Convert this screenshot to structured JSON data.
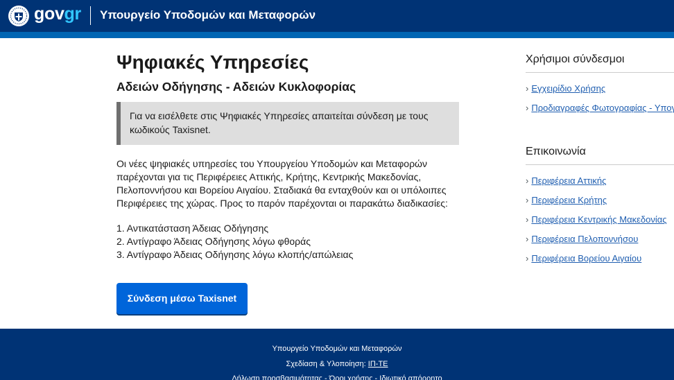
{
  "header": {
    "logo_gov": "gov",
    "logo_gr": "gr",
    "ministry_title": "Υπουργείο Υποδομών και Μεταφορών"
  },
  "main": {
    "title": "Ψηφιακές Υπηρεσίες",
    "subtitle": "Αδειών Οδήγησης - Αδειών Κυκλοφορίας",
    "notice_line1": "Για να εισέλθετε στις Ψηφιακές Υπηρεσίες απαιτείται σύνδεση με τους",
    "notice_line2": "κωδικούς Taxisnet.",
    "intro_lines": [
      "Οι νέες ψηφιακές υπηρεσίες του Υπουργείου Υποδομών και Μεταφορών",
      "παρέχονται για τις Περιφέρειες Αττικής, Κρήτης, Κεντρικής Μακεδονίας,",
      "Πελοποννήσου και Βορείου Αιγαίου. Σταδιακά θα ενταχθούν και οι υπόλοιπες",
      "Περιφέρειες της χώρας. Προς το παρόν παρέχονται οι παρακάτω διαδικασίες:"
    ],
    "procedures": [
      "1. Αντικατάσταση Άδειας Οδήγησης",
      "2. Αντίγραφο Άδειας Οδήγησης λόγω φθοράς",
      "3. Αντίγραφο Άδειας Οδήγησης λόγω κλοπής/απώλειας"
    ],
    "login_button": "Σύνδεση μέσω Taxisnet"
  },
  "sidebar": {
    "useful_heading": "Χρήσιμοι σύνδεσμοι",
    "useful_links": [
      "Εγχειρίδιο Χρήσης",
      "Προδιαγραφές Φωτογραφίας - Υπογρ"
    ],
    "contact_heading": "Επικοινωνία",
    "contact_links": [
      "Περιφέρεια Αττικής",
      "Περιφέρεια Κρήτης",
      "Περιφέρεια Κεντρικής Μακεδονίας",
      "Περιφέρεια Πελοποννήσου",
      "Περιφέρεια Βορείου Αιγαίου"
    ],
    "chevron": "›"
  },
  "footer": {
    "line1": "Υπουργείο Υποδομών και Μεταφορών",
    "design_label": "Σχεδίαση & Υλοποίηση:",
    "design_link": "ΙΠ-ΤΕ",
    "line3": "Δήλωση προσβασιμότητας - Όροι χρήσης - Ιδιωτικό απόρρητο"
  },
  "colors": {
    "header_bg": "#003375",
    "header_stripe": "#0065b3",
    "logo_gr": "#32c6ff",
    "button_bg": "#0065da",
    "link": "#1f5eb0",
    "notice_bg": "#dedede",
    "notice_border": "#6f6f6f"
  },
  "icons": {
    "emblem": "greek-coat-of-arms-icon"
  }
}
